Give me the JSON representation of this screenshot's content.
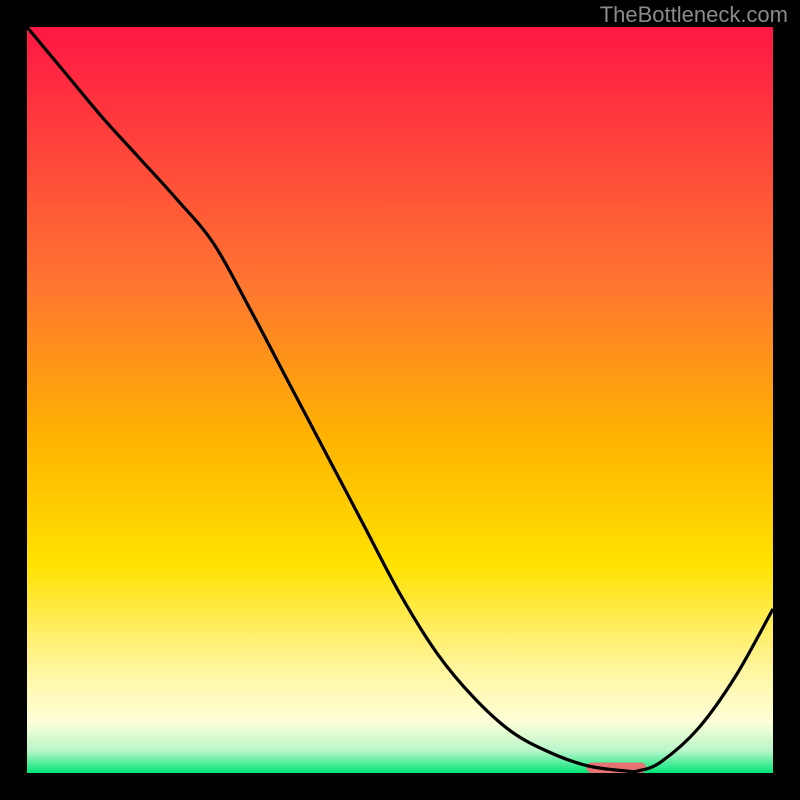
{
  "attribution": "TheBottleneck.com",
  "chart_data": {
    "type": "line",
    "title": "",
    "xlabel": "",
    "ylabel": "",
    "xlim": [
      0,
      100
    ],
    "ylim": [
      0,
      100
    ],
    "background_gradient": {
      "stops": [
        {
          "offset": 0.0,
          "color": "#ff1744"
        },
        {
          "offset": 0.35,
          "color": "#ff7730"
        },
        {
          "offset": 0.55,
          "color": "#ffb300"
        },
        {
          "offset": 0.72,
          "color": "#ffe200"
        },
        {
          "offset": 0.86,
          "color": "#fff59d"
        },
        {
          "offset": 0.93,
          "color": "#ffffd8"
        },
        {
          "offset": 0.97,
          "color": "#b9f6ca"
        },
        {
          "offset": 1.0,
          "color": "#00e676"
        }
      ]
    },
    "series": [
      {
        "name": "bottleneck-curve",
        "type": "line",
        "color": "#000000",
        "x": [
          0,
          5,
          10,
          15,
          20,
          25,
          30,
          35,
          40,
          45,
          50,
          55,
          60,
          65,
          70,
          75,
          80,
          82,
          85,
          90,
          95,
          100
        ],
        "y": [
          100,
          94,
          88,
          82.5,
          77,
          71,
          62,
          52.5,
          43,
          33.5,
          24,
          16,
          10,
          5.5,
          2.8,
          1,
          0.3,
          0.3,
          1.5,
          6,
          13,
          22
        ]
      }
    ],
    "marker": {
      "name": "optimal-range",
      "type": "bar",
      "color": "#e57373",
      "x_range": [
        75,
        83
      ],
      "y": 0.7,
      "height": 1.4
    }
  }
}
